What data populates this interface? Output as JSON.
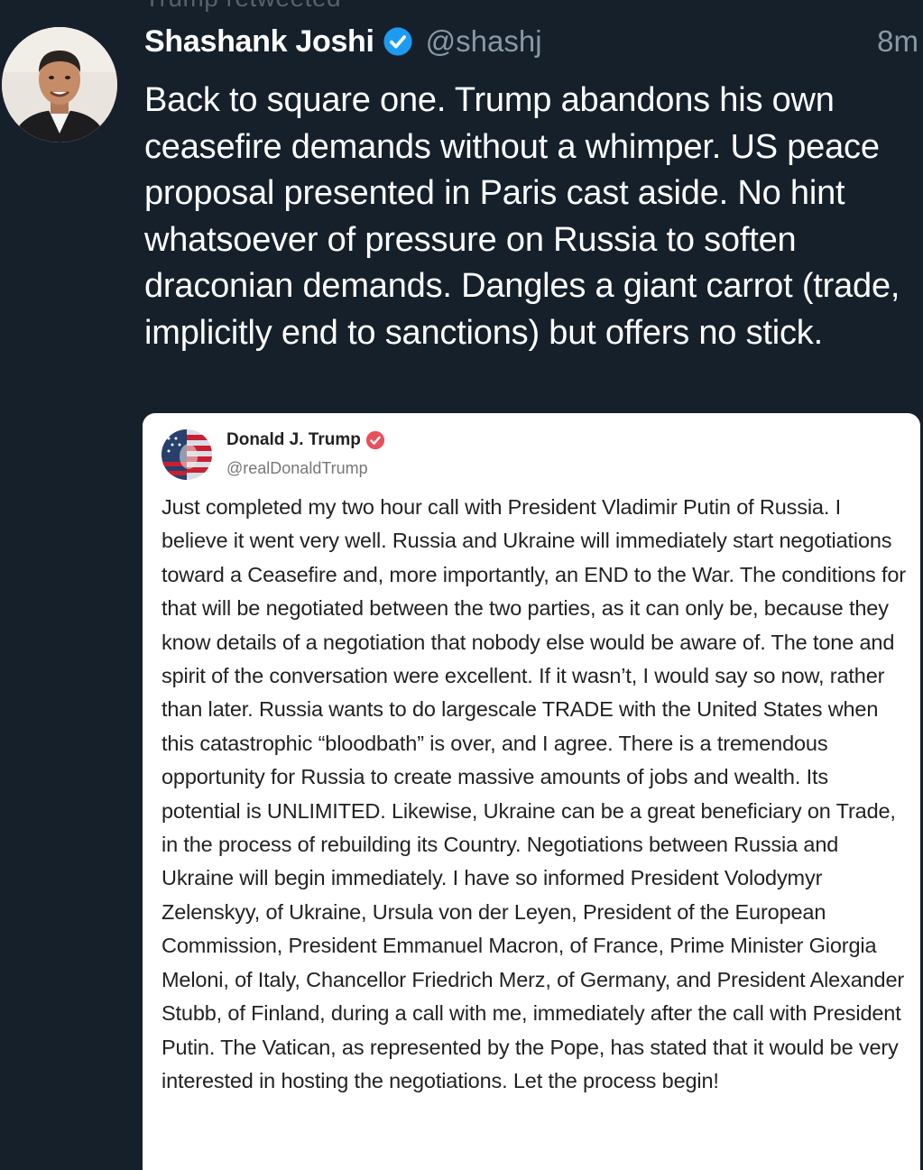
{
  "retweet_notice": "Trump retweeted",
  "tweet": {
    "author_name": "Shashank Joshi",
    "handle": "@shashj",
    "timestamp": "8m",
    "text": "Back to square one. Trump abandons his own ceasefire demands without a whimper. US peace proposal presented in Paris cast aside. No hint whatsoever of pressure on Russia to soften draconian demands. Dangles a giant carrot (trade, implicitly end to sanctions) but offers no stick."
  },
  "quoted_post": {
    "author_name": "Donald J. Trump",
    "handle": "@realDonaldTrump",
    "text": "Just completed my two hour call with President Vladimir Putin of Russia. I believe it went very well. Russia and Ukraine will immediately start negotiations toward a Ceasefire and, more importantly, an END to the War. The conditions for that will be negotiated between the two parties, as it can only be, because they know details of a negotiation that nobody else would be aware of. The tone and spirit of the conversation were excellent. If it wasn’t, I would say so now, rather than later. Russia wants to do largescale TRADE with the United States when this catastrophic “bloodbath” is over, and I agree. There is a tremendous opportunity for Russia to create massive amounts of jobs and wealth. Its potential is UNLIMITED. Likewise, Ukraine can be a great beneficiary on Trade, in the process of rebuilding its Country. Negotiations between Russia and Ukraine will begin immediately. I have so informed President Volodymyr Zelenskyy, of Ukraine, Ursula von der Leyen, President of the European Commission, President Emmanuel Macron, of France, Prime Minister Giorgia Meloni, of Italy, Chancellor Friedrich Merz, of Germany, and President Alexander Stubb, of Finland, during a call with me, immediately after the call with President Putin. The Vatican, as represented by the Pope, has stated that it would be very interested in hosting the negotiations. Let the process begin!"
  },
  "icons": {
    "author_verified": "verified-badge-icon",
    "quoted_verified": "verified-badge-icon"
  },
  "colors": {
    "background": "#15202b",
    "primary_text": "#ffffff",
    "secondary_text": "#8899a6",
    "twitter_verified": "#1d9bf0",
    "truth_verified": "#e8505b",
    "card_background": "#ffffff",
    "card_text": "#222222"
  }
}
